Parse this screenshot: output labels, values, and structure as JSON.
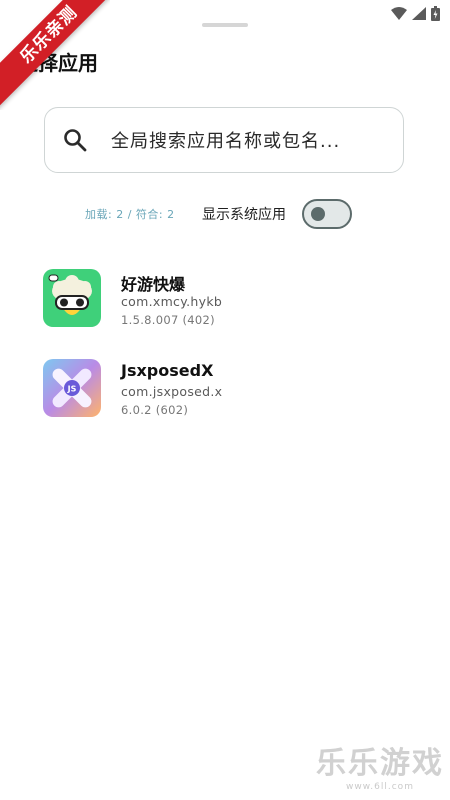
{
  "ribbon": {
    "text": "乐乐亲测"
  },
  "header": {
    "title": "选择应用"
  },
  "search": {
    "placeholder": "全局搜索应用名称或包名..."
  },
  "filter": {
    "counts": "加载: 2 / 符合: 2",
    "toggle_label": "显示系统应用",
    "toggle_on": false
  },
  "apps": [
    {
      "name": "好游快爆",
      "package": "com.xmcy.hykb",
      "version": "1.5.8.007 (402)",
      "icon": "haoyou-app-icon"
    },
    {
      "name": "JsxposedX",
      "package": "com.jsxposed.x",
      "version": "6.0.2 (602)",
      "icon": "jsxposedx-app-icon"
    }
  ],
  "watermark": {
    "title": "乐乐游戏",
    "url": "www.6ll.com"
  },
  "colors": {
    "accent_text": "#6aa6b8",
    "ribbon": "#d21f26",
    "toggle": "#5c6b6b"
  }
}
